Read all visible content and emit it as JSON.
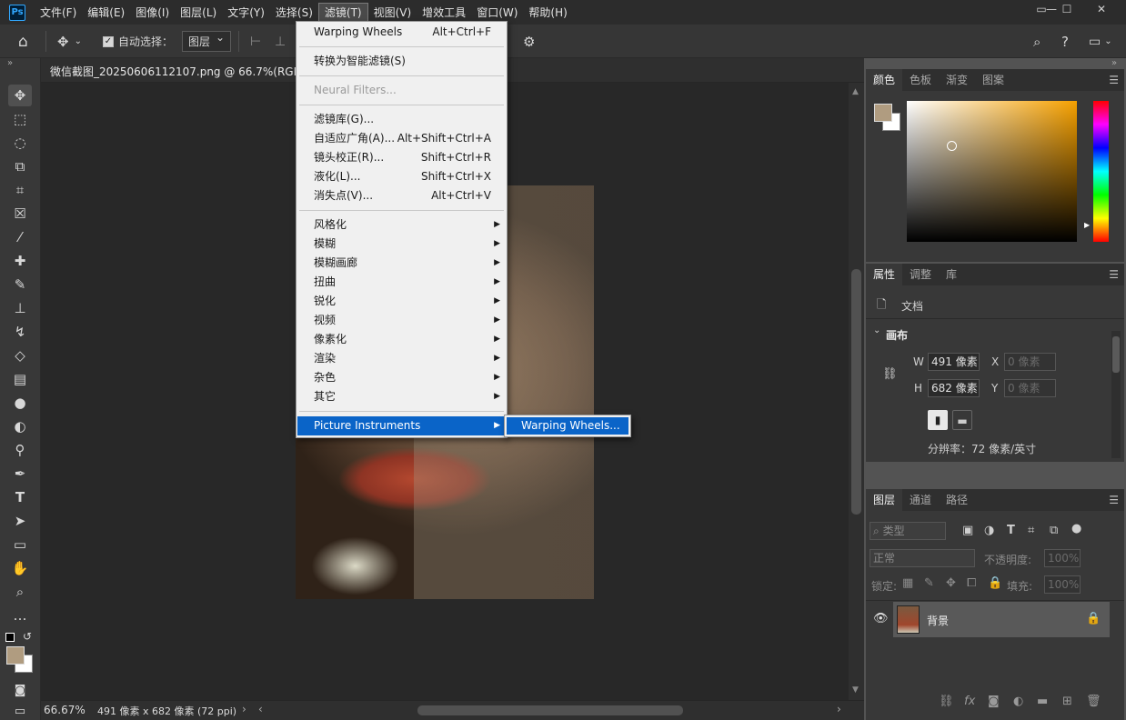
{
  "app": {
    "logo": "Ps"
  },
  "menubar": {
    "items": [
      "文件(F)",
      "编辑(E)",
      "图像(I)",
      "图层(L)",
      "文字(Y)",
      "选择(S)",
      "滤镜(T)",
      "视图(V)",
      "增效工具",
      "窗口(W)",
      "帮助(H)"
    ],
    "window_controls": [
      "▭",
      "—",
      "☐",
      "✕"
    ]
  },
  "options_bar": {
    "auto_select_label": "自动选择：",
    "auto_select_checked": "✓",
    "auto_select_target": "图层"
  },
  "document": {
    "tab_title": "微信截图_20250606112107.png @ 66.7%(RGB/8#) *",
    "zoom": "66.67%",
    "doc_info": "491 像素 x 682 像素 (72 ppi)"
  },
  "filter_menu": {
    "items": [
      {
        "label": "Warping Wheels",
        "shortcut": "Alt+Ctrl+F"
      },
      {
        "label": "转换为智能滤镜(S)"
      },
      {
        "label": "Neural Filters...",
        "disabled": true
      },
      {
        "label": "滤镜库(G)..."
      },
      {
        "label": "自适应广角(A)...",
        "shortcut": "Alt+Shift+Ctrl+A"
      },
      {
        "label": "镜头校正(R)...",
        "shortcut": "Shift+Ctrl+R"
      },
      {
        "label": "液化(L)...",
        "shortcut": "Shift+Ctrl+X"
      },
      {
        "label": "消失点(V)...",
        "shortcut": "Alt+Ctrl+V"
      },
      {
        "label": "风格化"
      },
      {
        "label": "模糊"
      },
      {
        "label": "模糊画廊"
      },
      {
        "label": "扭曲"
      },
      {
        "label": "锐化"
      },
      {
        "label": "视频"
      },
      {
        "label": "像素化"
      },
      {
        "label": "渲染"
      },
      {
        "label": "杂色"
      },
      {
        "label": "其它"
      },
      {
        "label": "Picture Instruments"
      }
    ],
    "submenu_item": "Warping Wheels..."
  },
  "color_panel": {
    "tabs": [
      "颜色",
      "色板",
      "渐变",
      "图案"
    ],
    "foreground": "#b09c80",
    "background": "#ffffff",
    "hue": "#f5a000"
  },
  "properties_panel": {
    "tabs": [
      "属性",
      "调整",
      "库"
    ],
    "doc_label": "文档",
    "section": "画布",
    "w_label": "W",
    "w_value": "491 像素",
    "h_label": "H",
    "h_value": "682 像素",
    "x_label": "X",
    "x_placeholder": "0 像素",
    "y_label": "Y",
    "y_placeholder": "0 像素",
    "resolution": "分辨率：72 像素/英寸"
  },
  "layers_panel": {
    "tabs": [
      "图层",
      "通道",
      "路径"
    ],
    "filter_type": "类型",
    "blend_mode": "正常",
    "opacity_label": "不透明度:",
    "opacity_value": "100%",
    "lock_label": "锁定:",
    "fill_label": "填充:",
    "fill_value": "100%",
    "layer_name": "背景"
  }
}
